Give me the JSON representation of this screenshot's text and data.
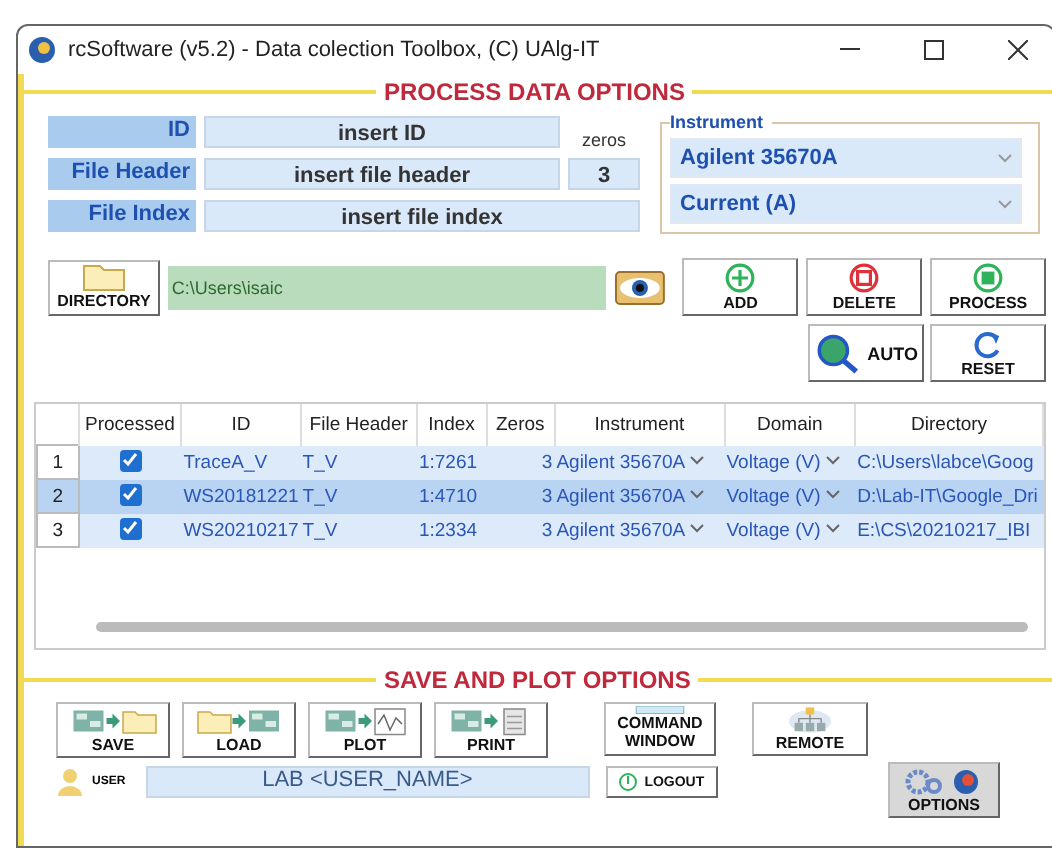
{
  "window": {
    "title": "rcSoftware (v5.2) - Data colection Toolbox, (C) UAlg-IT"
  },
  "process_section": {
    "title": "PROCESS DATA OPTIONS",
    "fields": [
      {
        "label": "ID",
        "value": "insert ID"
      },
      {
        "label": "File Header",
        "value": "insert file header"
      },
      {
        "label": "File Index",
        "value": "insert file index"
      }
    ],
    "zeros": {
      "label": "zeros",
      "value": "3"
    },
    "instrument": {
      "title": "Instrument",
      "dropdowns": [
        "Agilent 35670A",
        "Current (A)"
      ]
    },
    "directory": {
      "button": "DIRECTORY",
      "path": "C:\\Users\\isaic"
    },
    "buttons": [
      {
        "kind": "add",
        "label": "ADD"
      },
      {
        "kind": "delete",
        "label": "DELETE"
      },
      {
        "kind": "process",
        "label": "PROCESS"
      },
      {
        "kind": "auto",
        "label": "AUTO"
      },
      {
        "kind": "reset",
        "label": "RESET"
      }
    ]
  },
  "table": {
    "columns": [
      "Processed",
      "ID",
      "File Header",
      "Index",
      "Zeros",
      "Instrument",
      "Domain",
      "Directory"
    ],
    "rows": [
      {
        "number": "1",
        "processed": true,
        "selected": false,
        "id": "TraceA_V",
        "file_header": "T_V",
        "index": "1:7261",
        "zeros": "3",
        "instrument": "Agilent 35670A",
        "domain": "Voltage (V)",
        "directory": "C:\\Users\\labce\\Goog"
      },
      {
        "number": "2",
        "processed": true,
        "selected": true,
        "id": "WS20181221",
        "file_header": "T_V",
        "index": "1:4710",
        "zeros": "3",
        "instrument": "Agilent 35670A",
        "domain": "Voltage (V)",
        "directory": "D:\\Lab-IT\\Google_Dri"
      },
      {
        "number": "3",
        "processed": true,
        "selected": false,
        "id": "WS20210217",
        "file_header": "T_V",
        "index": "1:2334",
        "zeros": "3",
        "instrument": "Agilent 35670A",
        "domain": "Voltage (V)",
        "directory": "E:\\CS\\20210217_IBI"
      }
    ]
  },
  "save_section": {
    "title": "SAVE AND PLOT OPTIONS",
    "buttons": [
      {
        "kind": "save",
        "label": "SAVE"
      },
      {
        "kind": "load",
        "label": "LOAD"
      },
      {
        "kind": "plot",
        "label": "PLOT"
      },
      {
        "kind": "print",
        "label": "PRINT"
      },
      {
        "kind": "command",
        "label": "COMMAND WINDOW"
      },
      {
        "kind": "remote",
        "label": "REMOTE"
      }
    ],
    "user": {
      "label": "USER",
      "value": "LAB <USER_NAME>"
    },
    "logout": "LOGOUT",
    "options": "OPTIONS"
  }
}
